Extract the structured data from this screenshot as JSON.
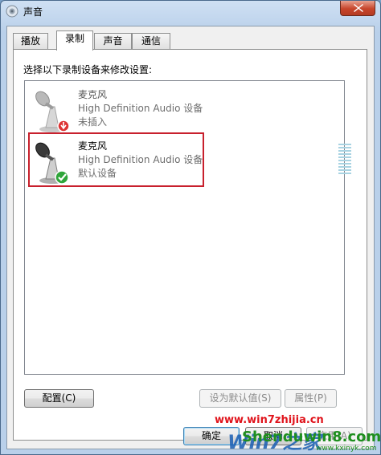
{
  "window": {
    "title": "声音"
  },
  "tabs": [
    {
      "label": "播放"
    },
    {
      "label": "录制"
    },
    {
      "label": "声音"
    },
    {
      "label": "通信"
    }
  ],
  "instruction": "选择以下录制设备来修改设置:",
  "devices": [
    {
      "name": "麦克风",
      "driver": "High Definition Audio 设备",
      "status": "未插入"
    },
    {
      "name": "麦克风",
      "driver": "High Definition Audio 设备",
      "status": "默认设备"
    }
  ],
  "buttons": {
    "configure": "配置(C)",
    "set_default": "设为默认值(S)",
    "properties": "属性(P)",
    "ok": "确定",
    "cancel": "取消",
    "apply": "应用(A)"
  },
  "watermarks": {
    "site1": "www.win7zhijia.cn",
    "logo1": "Win7之家",
    "site2": "Shenduwin8.com",
    "site3": "www.kxinyk.com"
  },
  "colors": {
    "highlight": "#c8202d",
    "watermark_red": "#e0141c",
    "watermark_green": "#1f8f1f"
  }
}
